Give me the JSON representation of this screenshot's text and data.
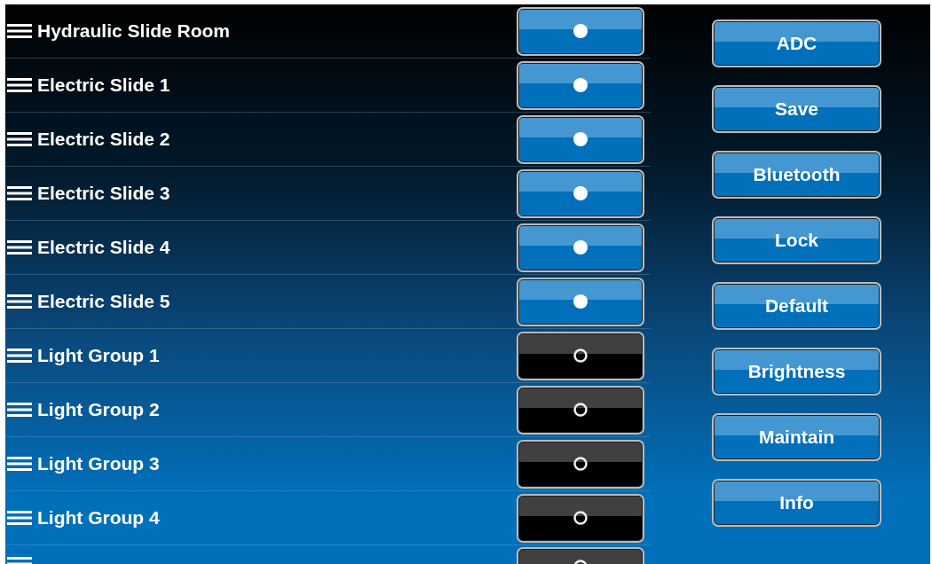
{
  "rows": [
    {
      "label": "Hydraulic Slide Room",
      "on": true
    },
    {
      "label": "Electric Slide 1",
      "on": true
    },
    {
      "label": "Electric Slide 2",
      "on": true
    },
    {
      "label": "Electric Slide 3",
      "on": true
    },
    {
      "label": "Electric Slide 4",
      "on": true
    },
    {
      "label": "Electric Slide 5",
      "on": true
    },
    {
      "label": "Light Group 1",
      "on": false
    },
    {
      "label": "Light Group 2",
      "on": false
    },
    {
      "label": "Light Group 3",
      "on": false
    },
    {
      "label": "Light Group 4",
      "on": false
    },
    {
      "on": false
    }
  ],
  "buttons": [
    "ADC",
    "Save",
    "Bluetooth",
    "Lock",
    "Default",
    "Brightness",
    "Maintain",
    "Info"
  ]
}
